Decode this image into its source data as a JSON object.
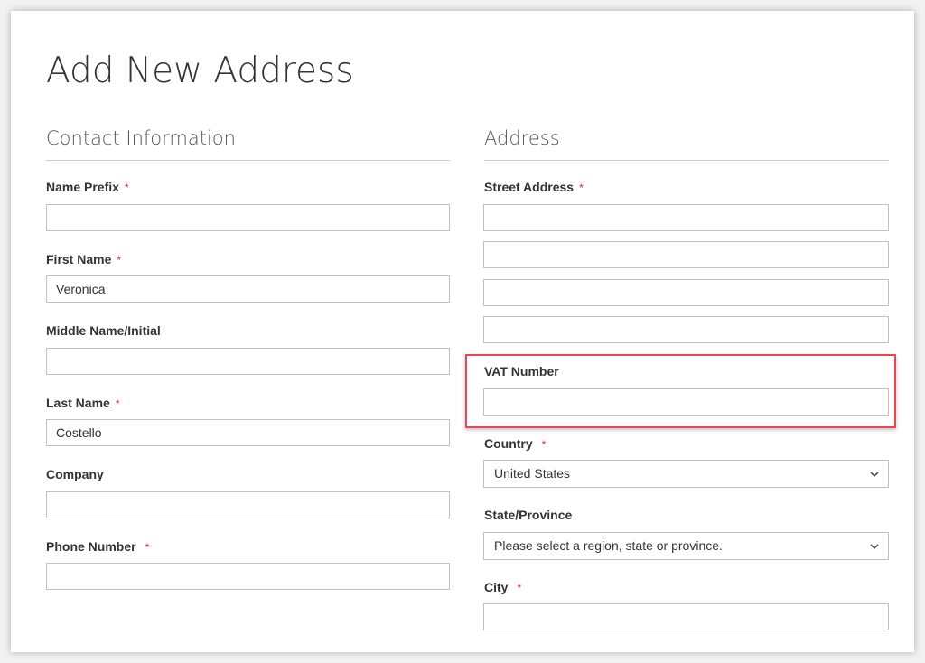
{
  "page": {
    "title": "Add New Address"
  },
  "contact": {
    "heading": "Contact Information",
    "fields": {
      "name_prefix": {
        "label": "Name Prefix",
        "value": "",
        "required": true
      },
      "first_name": {
        "label": "First Name",
        "value": "Veronica",
        "required": true
      },
      "middle_name": {
        "label": "Middle Name/Initial",
        "value": "",
        "required": false
      },
      "last_name": {
        "label": "Last Name",
        "value": "Costello",
        "required": true
      },
      "company": {
        "label": "Company",
        "value": "",
        "required": false
      },
      "phone": {
        "label": "Phone Number",
        "value": "",
        "required": true
      }
    }
  },
  "address": {
    "heading": "Address",
    "fields": {
      "street": {
        "label": "Street Address",
        "lines": [
          "",
          "",
          "",
          ""
        ],
        "required": true
      },
      "vat": {
        "label": "VAT Number",
        "value": "",
        "required": false
      },
      "country": {
        "label": "Country",
        "selected": "United States",
        "required": true
      },
      "state": {
        "label": "State/Province",
        "selected": "Please select a region, state or province.",
        "required": false
      },
      "city": {
        "label": "City",
        "value": "",
        "required": true
      }
    }
  },
  "required_marker": "*",
  "colors": {
    "required": "#e02b27",
    "highlight": "#e8474f"
  }
}
